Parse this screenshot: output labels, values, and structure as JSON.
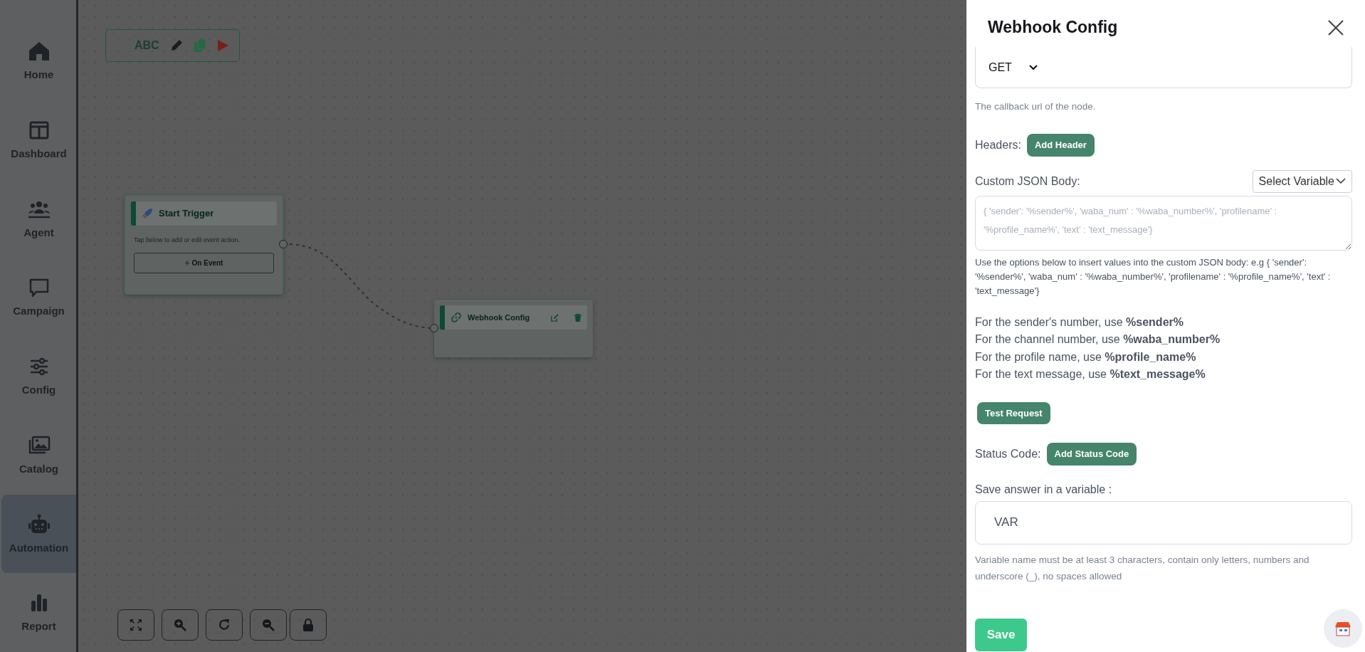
{
  "sidebar": {
    "items": [
      {
        "kind": "home",
        "label": "Home",
        "selected": false
      },
      {
        "kind": "dashboard",
        "label": "Dashboard",
        "selected": false
      },
      {
        "kind": "agent",
        "label": "Agent",
        "selected": false
      },
      {
        "kind": "campaign",
        "label": "Campaign",
        "selected": false
      },
      {
        "kind": "config",
        "label": "Config",
        "selected": false
      },
      {
        "kind": "catalog",
        "label": "Catalog",
        "selected": false
      },
      {
        "kind": "automation",
        "label": "Automation",
        "selected": true
      },
      {
        "kind": "report",
        "label": "Report",
        "selected": false
      }
    ]
  },
  "canvas": {
    "toolbar": {
      "label": "ABC"
    },
    "nodes": [
      {
        "kind": "trigger",
        "title": "Start Trigger",
        "description": "Tap below to add or edit event action.",
        "button": "On Event"
      },
      {
        "kind": "action",
        "title": "Webhook Config"
      }
    ]
  },
  "panel": {
    "title": "Webhook Config",
    "method": {
      "value": "GET"
    },
    "method_help": "The callback url of the node.",
    "headers_label": "Headers:",
    "add_header_button": "Add Header",
    "body_label": "Custom JSON Body:",
    "select_variable": "Select Variable",
    "body_placeholder": "{ 'sender': '%sender%', 'waba_num' : '%waba_number%', 'profilename' : '%profile_name%', 'text' : 'text_message'}",
    "body_help": "Use the options below to insert values into the custom JSON body: e.g { 'sender': '%sender%', 'waba_num' : '%waba_number%', 'profilename' : '%profile_name%', 'text' : 'text_message'}",
    "hints": [
      "For the sender's number, use **%sender%**",
      "For the channel number, use **%waba_number%**",
      "For the profile name, use **%profile_name%**",
      "For the text message, use **%text_message%**"
    ],
    "test_button": "Test Request",
    "status_label": "Status Code:",
    "status_button": "Add Status Code",
    "save_label": "Save answer in a variable :",
    "save_value": "VAR",
    "save_help": "Variable name must be at least 3 characters, contain only letters, numbers and underscore (_), no spaces allowed",
    "save_button": "Save"
  }
}
